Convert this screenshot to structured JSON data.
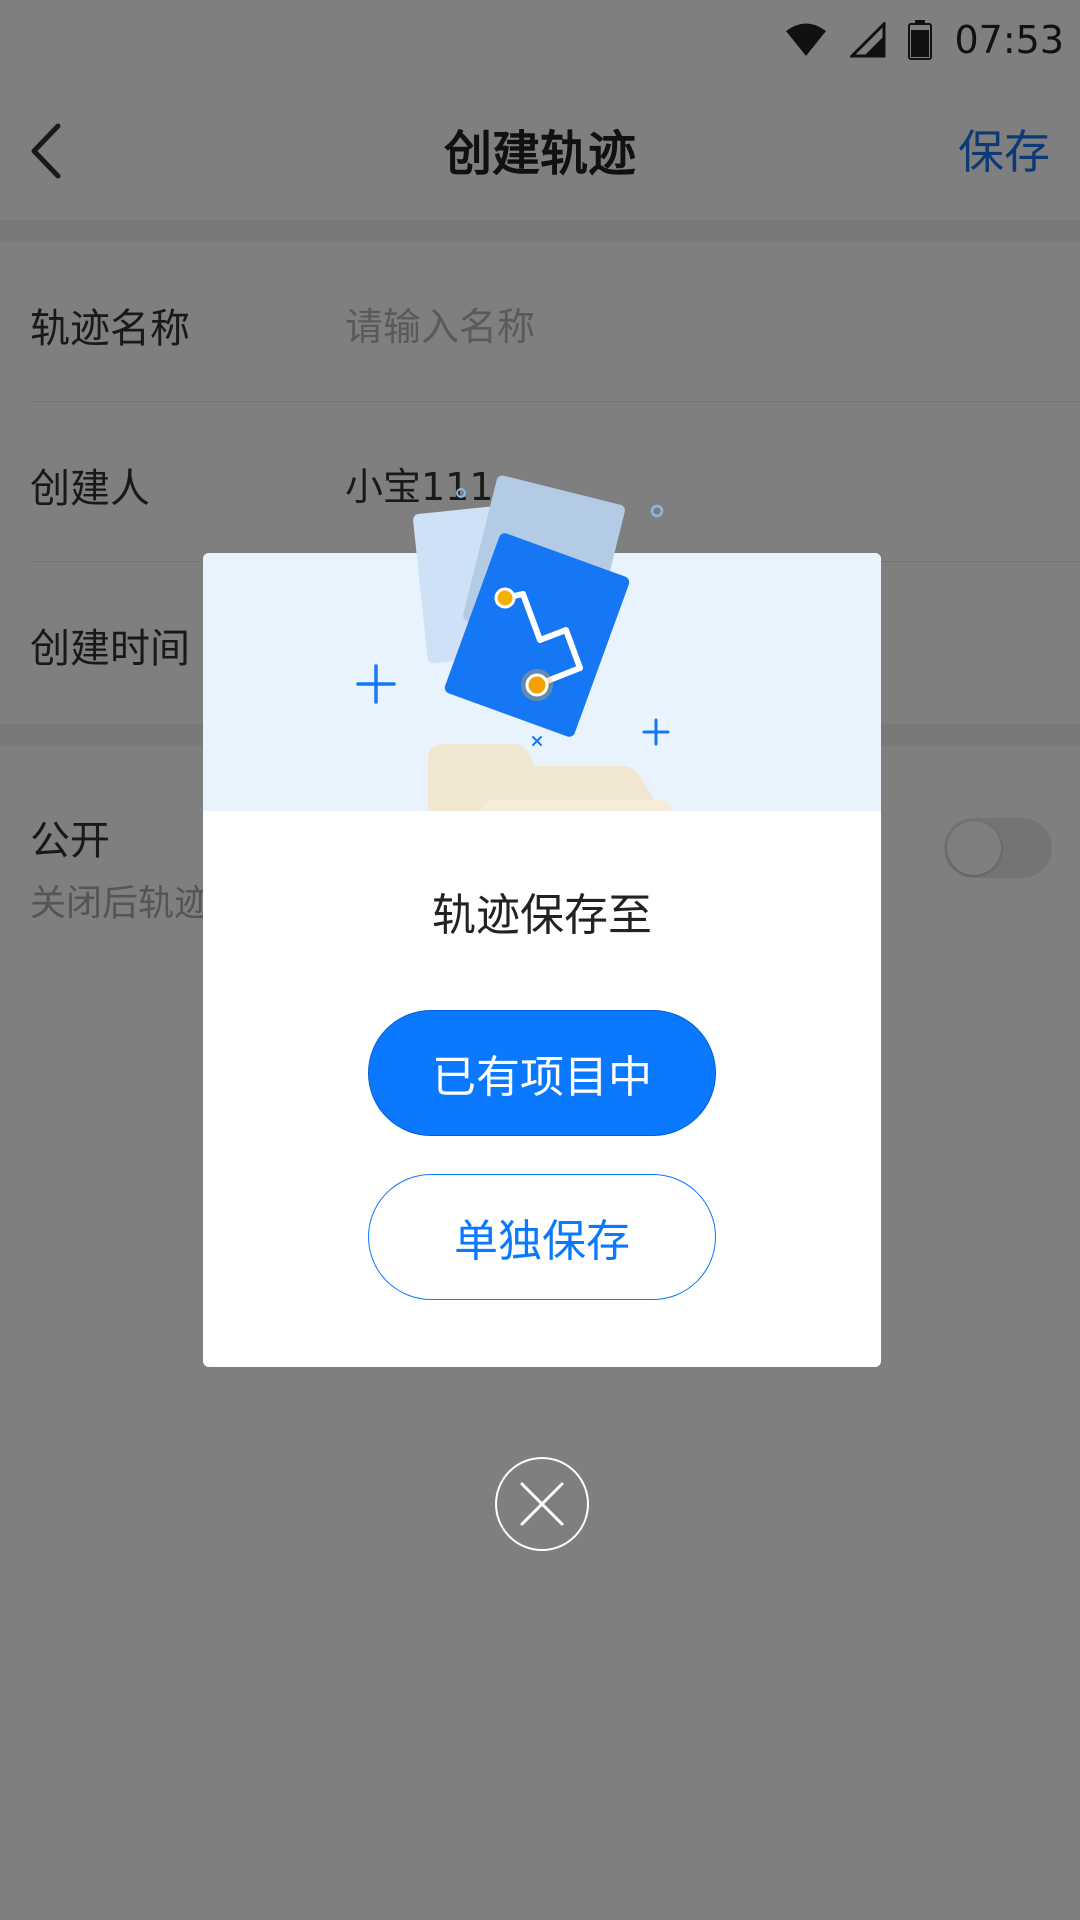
{
  "status_bar": {
    "time": "07:53",
    "icons": [
      "wifi-icon",
      "cellular-signal-icon",
      "battery-icon"
    ]
  },
  "nav": {
    "back_icon": "chevron-left-icon",
    "title": "创建轨迹",
    "save_label": "保存"
  },
  "form": {
    "name": {
      "label": "轨迹名称",
      "placeholder": "请输入名称"
    },
    "creator": {
      "label": "创建人",
      "value": "小宝111"
    },
    "created_time": {
      "label": "创建时间"
    }
  },
  "public": {
    "label": "公开",
    "description": "关闭后轨迹",
    "toggle_on": false
  },
  "dialog": {
    "title": "轨迹保存至",
    "primary_button": "已有项目中",
    "secondary_button": "单独保存",
    "close_icon": "close-icon",
    "illustration": "track-file-folder-illustration"
  },
  "colors": {
    "accent": "#0a78ff",
    "nav_save": "#1a73e8",
    "banner_bg": "#e9f3fd",
    "overlay": "rgba(0,0,0,0.5)"
  }
}
